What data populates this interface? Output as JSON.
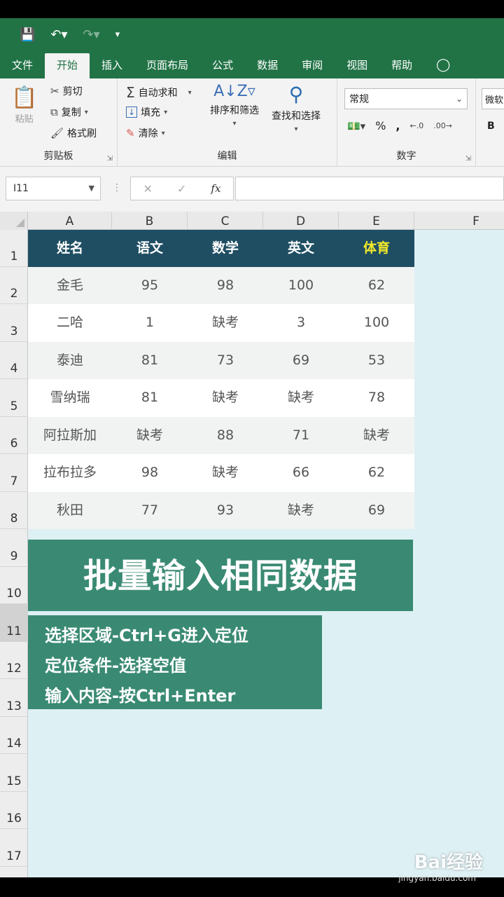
{
  "ribbon_tabs": [
    "文件",
    "开始",
    "插入",
    "页面布局",
    "公式",
    "数据",
    "审阅",
    "视图",
    "帮助"
  ],
  "active_tab": "开始",
  "clipboard": {
    "paste": "粘贴",
    "cut": "剪切",
    "copy": "复制",
    "format_painter": "格式刷",
    "label": "剪贴板"
  },
  "editing": {
    "autosum": "自动求和",
    "fill": "填充",
    "clear": "清除",
    "sort_filter": "排序和筛选",
    "find_select": "查找和选择",
    "label": "编辑"
  },
  "number": {
    "format": "常规",
    "label": "数字",
    "percent": "%",
    "comma": ","
  },
  "font": {
    "name_partial": "微软",
    "bold": "B"
  },
  "name_box": "I11",
  "fx_label": "fx",
  "columns": [
    "A",
    "B",
    "C",
    "D",
    "E",
    "F"
  ],
  "rows": [
    "1",
    "2",
    "3",
    "4",
    "5",
    "6",
    "7",
    "8",
    "9",
    "10",
    "11",
    "12",
    "13",
    "14",
    "15",
    "16",
    "17"
  ],
  "table": {
    "headers": [
      "姓名",
      "语文",
      "数学",
      "英文",
      "体育"
    ],
    "highlight_color": "#f4ea2a",
    "header_bg": "#1f4e63",
    "data": [
      [
        "金毛",
        "95",
        "98",
        "100",
        "62"
      ],
      [
        "二哈",
        "1",
        "缺考",
        "3",
        "100"
      ],
      [
        "泰迪",
        "81",
        "73",
        "69",
        "53"
      ],
      [
        "雪纳瑞",
        "81",
        "缺考",
        "缺考",
        "78"
      ],
      [
        "阿拉斯加",
        "缺考",
        "88",
        "71",
        "缺考"
      ],
      [
        "拉布拉多",
        "98",
        "缺考",
        "66",
        "62"
      ],
      [
        "秋田",
        "77",
        "93",
        "缺考",
        "69"
      ]
    ]
  },
  "banner": {
    "title": "批量输入相同数据",
    "color": "#3a8a73"
  },
  "tips": [
    "选择区域-Ctrl+G进入定位",
    "定位条件-选择空值",
    "输入内容-按Ctrl+Enter"
  ],
  "watermark": {
    "logo": "Bai经验",
    "url": "jingyan.baidu.com"
  }
}
